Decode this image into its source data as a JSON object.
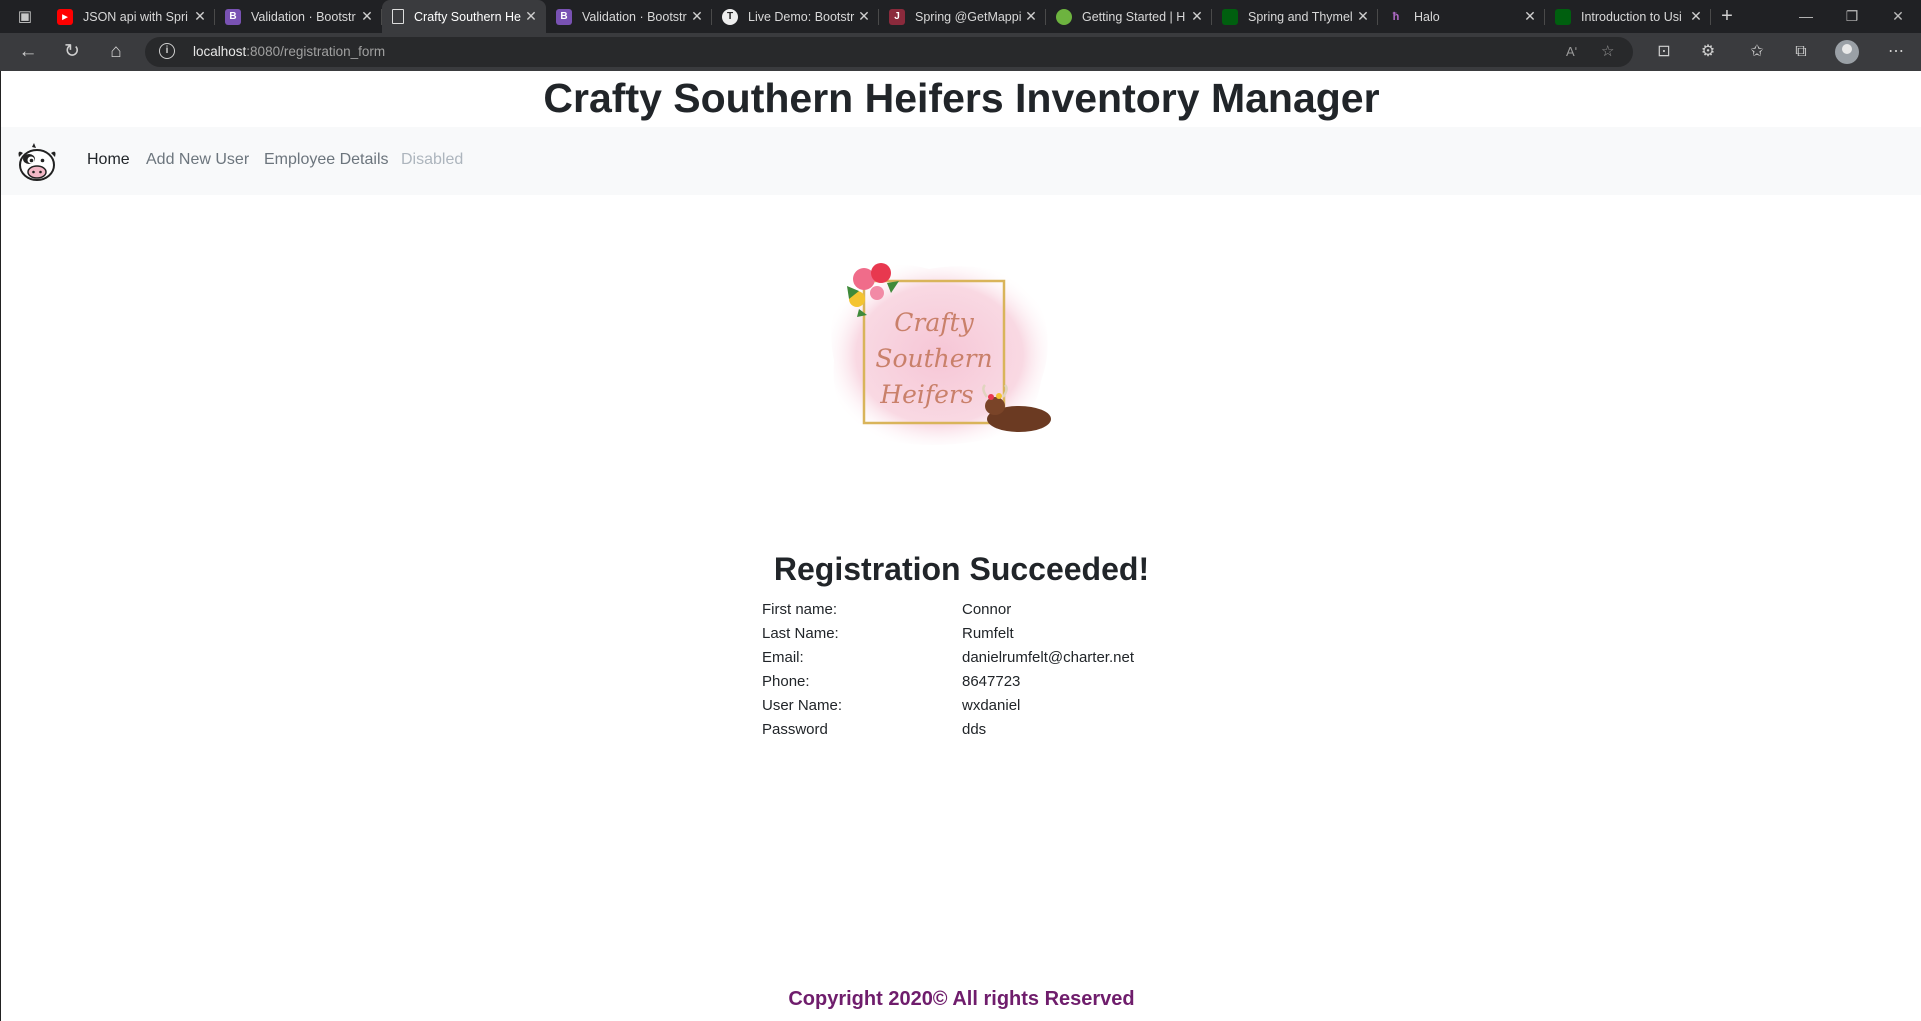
{
  "browser": {
    "tabs": [
      {
        "title": "JSON api with Spri",
        "favicon": "youtube-icon",
        "active": false
      },
      {
        "title": "Validation · Bootstr",
        "favicon": "bootstrap-icon",
        "active": false
      },
      {
        "title": "Crafty Southern He",
        "favicon": "page-icon",
        "active": true
      },
      {
        "title": "Validation · Bootstr",
        "favicon": "bootstrap-icon",
        "active": false
      },
      {
        "title": "Live Demo: Bootstr",
        "favicon": "tutorialrepublic-icon",
        "active": false
      },
      {
        "title": "Spring @GetMappi",
        "favicon": "java-icon",
        "active": false
      },
      {
        "title": "Getting Started | H",
        "favicon": "spring-icon",
        "active": false
      },
      {
        "title": "Spring and Thymel",
        "favicon": "thymeleaf-icon",
        "active": false
      },
      {
        "title": "Halo",
        "favicon": "halo-icon",
        "active": false
      },
      {
        "title": "Introduction to Usi",
        "favicon": "thymeleaf-icon",
        "active": false
      }
    ],
    "url_host": "localhost",
    "url_rest": ":8080/registration_form",
    "read_aloud": "Aʹ"
  },
  "page": {
    "site_title": "Crafty Southern Heifers Inventory Manager",
    "nav": {
      "home": "Home",
      "add_user": "Add New User",
      "employee_details": "Employee Details",
      "disabled": "Disabled"
    },
    "logo_text": [
      "Crafty",
      "Southern",
      "Heifers"
    ],
    "result_title": "Registration Succeeded!",
    "fields": [
      {
        "label": "First name:",
        "value": "Connor"
      },
      {
        "label": "Last Name:",
        "value": "Rumfelt"
      },
      {
        "label": "Email:",
        "value": "danielrumfelt@charter.net"
      },
      {
        "label": "Phone:",
        "value": "8647723"
      },
      {
        "label": "User Name:",
        "value": "wxdaniel"
      },
      {
        "label": "Password",
        "value": "dds"
      }
    ],
    "footer": "Copyright 2020© All rights Reserved"
  },
  "colors": {
    "footer_text": "#6f1d6c",
    "navbar_bg": "#f8f9fa",
    "chrome_dark": "#202124",
    "chrome_toolbar": "#3a3b3e"
  }
}
